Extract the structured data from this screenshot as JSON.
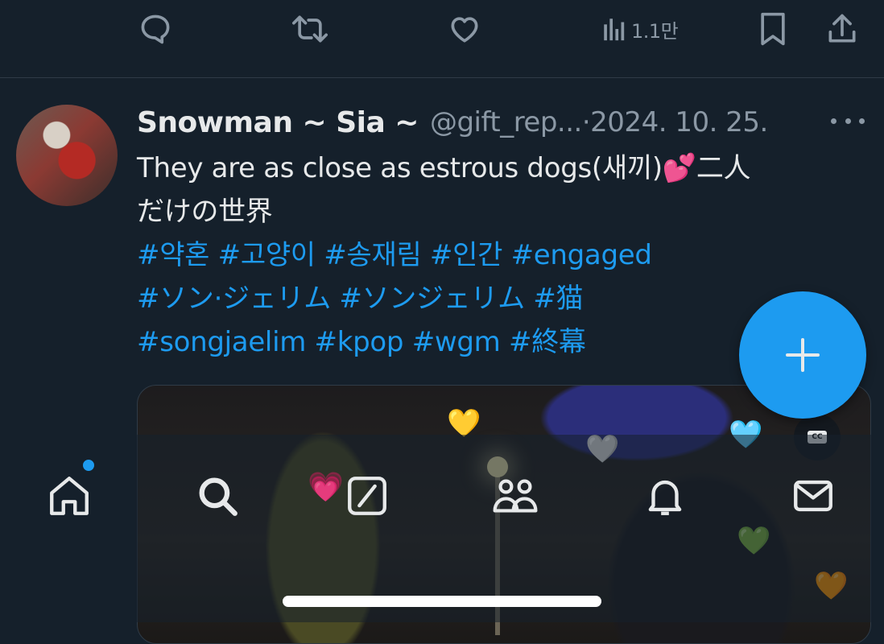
{
  "action_bar": {
    "views_count": "1.1만",
    "icons": [
      "reply-icon",
      "retweet-icon",
      "like-icon",
      "views-icon",
      "bookmark-icon",
      "share-icon"
    ]
  },
  "tweet": {
    "display_name": "Snowman ~ Sia ~",
    "handle": "@gift_rep...",
    "separator": "·",
    "date": "2024. 10. 25.",
    "text_line1": "They are as close as estrous dogs(새끼)",
    "text_emoji": "💕",
    "text_line1_end": "二人",
    "text_line2": "だけの世界",
    "hashtags_line1": "#약혼 #고양이 #송재림 #인간 #engaged",
    "hashtags_line2": "#ソン·ジェリム #ソンジェリム #猫",
    "hashtags_line3": "#songjaelim #kpop #wgm #終幕"
  },
  "media": {
    "cc_label": "CC",
    "floating_hearts": [
      "💛",
      "🤍",
      "🩵",
      "💚",
      "🧡"
    ]
  },
  "bottom_nav": {
    "items": [
      "home-icon",
      "search-icon",
      "grok-icon",
      "communities-icon",
      "notifications-icon",
      "messages-icon"
    ],
    "overlay_heart": "💗"
  },
  "fab": {
    "label": "+"
  },
  "colors": {
    "background": "#15202b",
    "accent": "#1d9bf0",
    "muted": "#8b98a5",
    "text": "#e7e9ea"
  }
}
